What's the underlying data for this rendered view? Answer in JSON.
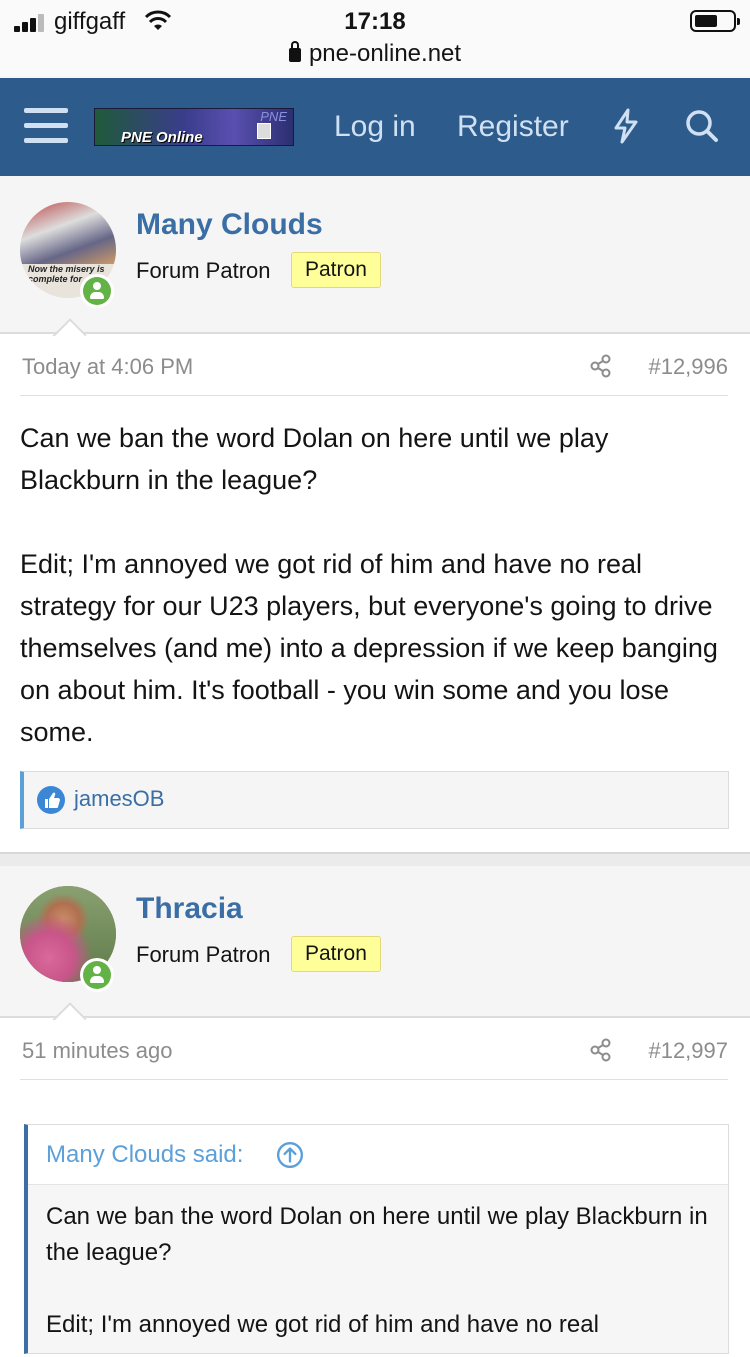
{
  "status_bar": {
    "carrier": "giffgaff",
    "time": "17:18",
    "url": "pne-online.net"
  },
  "nav": {
    "logo_text": "PNE Online",
    "logo_corner": "PNE",
    "login": "Log in",
    "register": "Register"
  },
  "posts": [
    {
      "author": "Many Clouds",
      "user_title": "Forum Patron",
      "badge": "Patron",
      "avatar_caption": "Now the misery is complete for",
      "time": "Today at 4:06 PM",
      "number": "#12,996",
      "paragraphs": [
        "Can we ban the word Dolan on here until we play Blackburn in the league?",
        "Edit; I'm annoyed we got rid of him and have no real strategy for our U23 players, but everyone's going to drive themselves (and me) into a depression if we keep banging on about him. It's football - you win some and you lose some."
      ],
      "reaction_user": "jamesOB"
    },
    {
      "author": "Thracia",
      "user_title": "Forum Patron",
      "badge": "Patron",
      "time": "51 minutes ago",
      "number": "#12,997",
      "quote": {
        "header": "Many Clouds said:",
        "paragraphs": [
          "Can we ban the word Dolan on here until we play Blackburn in the league?",
          "Edit; I'm annoyed we got rid of him and have no real"
        ]
      }
    }
  ]
}
